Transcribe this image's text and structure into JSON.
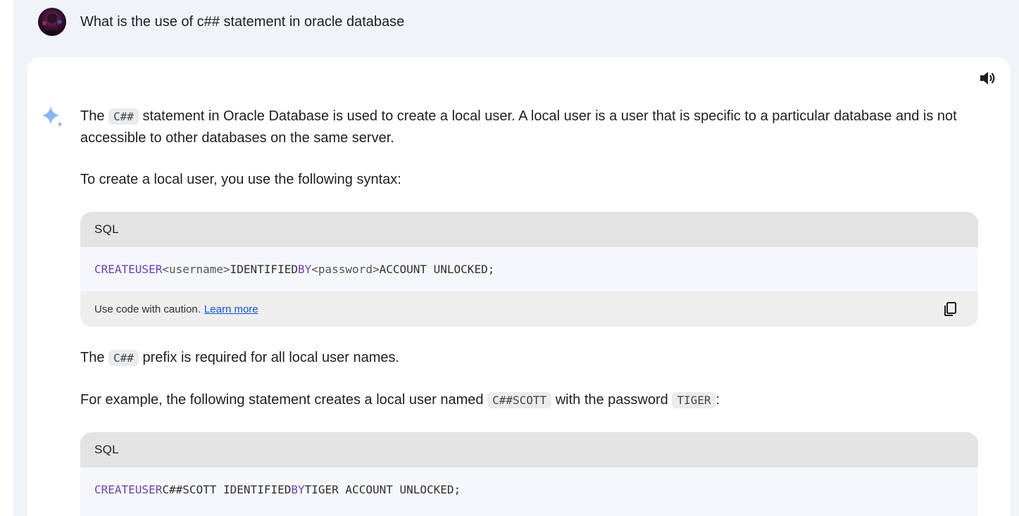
{
  "prompt": {
    "text": "What is the use of c## statement in oracle database"
  },
  "response": {
    "p1_prefix": "The ",
    "p1_code": "C##",
    "p1_line1_rest": " statement in Oracle Database is used to create a local user. A local user is a user that is specific to a particular database and is not",
    "p1_line2": "accessible to other databases on the same server.",
    "p2": "To create a local user, you use the following syntax:",
    "code_block_1": {
      "lang": "SQL",
      "kw_create": "CREATE",
      "kw_user": "USER",
      "ph_username": "<username>",
      "identified": "IDENTIFIED",
      "kw_by": "BY",
      "ph_password": "<password>",
      "tail": "ACCOUNT UNLOCKED;",
      "caution": "Use code with caution.",
      "learn_more": "Learn more"
    },
    "p3_prefix": "The ",
    "p3_code": "C##",
    "p3_rest": " prefix is required for all local user names.",
    "p4_prefix": "For example, the following statement creates a local user named ",
    "p4_code1": "C##SCOTT",
    "p4_mid": " with the password ",
    "p4_code2": "TIGER",
    "p4_end": ":",
    "code_block_2": {
      "lang": "SQL",
      "kw_create": "CREATE",
      "kw_user": "USER",
      "mid": "C##SCOTT IDENTIFIED",
      "kw_by": "BY",
      "tail": "TIGER ACCOUNT UNLOCKED;"
    }
  },
  "icons": {
    "avatar": "user-avatar",
    "speaker": "volume-icon",
    "spark": "gemini-spark-icon",
    "copy": "copy-icon"
  },
  "colors": {
    "keyword": "#6b3fb3",
    "link": "#0b57d0",
    "spark": "#4e8df5"
  }
}
